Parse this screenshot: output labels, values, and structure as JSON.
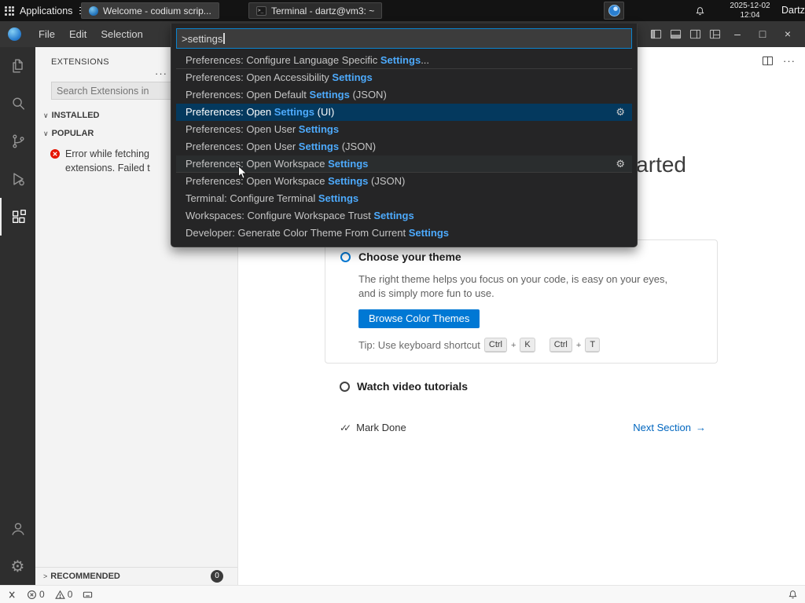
{
  "colors": {
    "accent": "#0078d4",
    "palette_selection": "#04395e",
    "match_highlight": "#4daafc",
    "error_red": "#e51400"
  },
  "taskbar": {
    "applications": "Applications",
    "window_buttons": [
      {
        "label": "Welcome - codium scrip..."
      },
      {
        "label": "Terminal - dartz@vm3: ~"
      }
    ],
    "date": "2025-12-02",
    "time": "12:04",
    "user": "Dartz"
  },
  "titlebar": {
    "menus": [
      "File",
      "Edit",
      "Selection"
    ]
  },
  "palette": {
    "input": ">settings",
    "items": [
      {
        "pre": "Preferences: Configure Language Specific ",
        "match": "Settings",
        "post": "..."
      },
      {
        "pre": "Preferences: Open Accessibility ",
        "match": "Settings",
        "post": ""
      },
      {
        "pre": "Preferences: Open Default ",
        "match": "Settings",
        "post": " (JSON)"
      },
      {
        "pre": "Preferences: Open ",
        "match": "Settings",
        "post": " (UI)"
      },
      {
        "pre": "Preferences: Open User ",
        "match": "Settings",
        "post": ""
      },
      {
        "pre": "Preferences: Open User ",
        "match": "Settings",
        "post": " (JSON)"
      },
      {
        "pre": "Preferences: Open Workspace ",
        "match": "Settings",
        "post": ""
      },
      {
        "pre": "Preferences: Open Workspace ",
        "match": "Settings",
        "post": " (JSON)"
      },
      {
        "pre": "Terminal: Configure Terminal ",
        "match": "Settings",
        "post": ""
      },
      {
        "pre": "Workspaces: Configure Workspace Trust ",
        "match": "Settings",
        "post": ""
      },
      {
        "pre": "Developer: Generate Color Theme From Current ",
        "match": "Settings",
        "post": ""
      }
    ]
  },
  "sidebar": {
    "title": "EXTENSIONS",
    "search_placeholder": "Search Extensions in",
    "installed": "INSTALLED",
    "popular": "POPULAR",
    "error_message": "Error while fetching extensions. Failed t",
    "recommended": "RECOMMENDED",
    "recommended_badge": "0"
  },
  "welcome": {
    "heading": "Get started",
    "theme_title": "Choose your theme",
    "theme_description": "The right theme helps you focus on your code, is easy on your eyes, and is simply more fun to use.",
    "browse_button": "Browse Color Themes",
    "tip_text": "Tip: Use keyboard shortcut",
    "key1": "Ctrl",
    "key2": "K",
    "key3": "Ctrl",
    "key4": "T",
    "plus": "+",
    "video_label": "Watch video tutorials",
    "mark_done": "Mark Done",
    "next_section": "Next Section"
  },
  "statusbar": {
    "error_count": "0",
    "warning_count": "0"
  },
  "icons": {
    "gear": "⚙",
    "check_all": "✓✓",
    "arrow_right": "→",
    "chevron_down": "∨",
    "chevron_right": ">",
    "more": "···",
    "minimize": "–",
    "maximize": "□",
    "close": "×"
  }
}
